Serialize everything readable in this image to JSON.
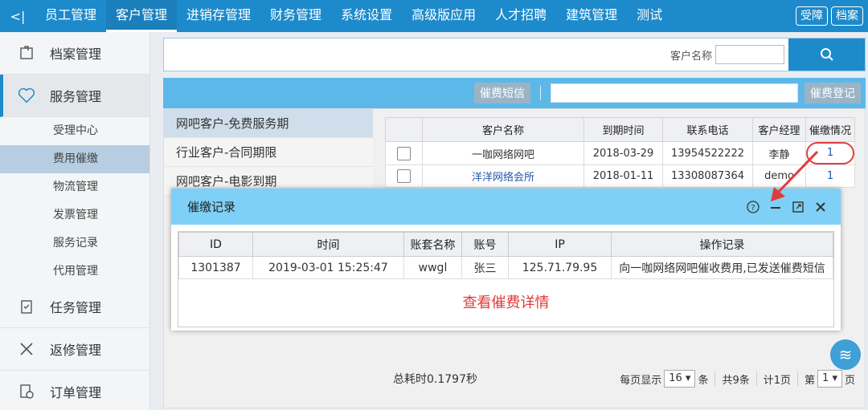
{
  "topnav": {
    "back": "<|",
    "items": [
      "员工管理",
      "客户管理",
      "进销存管理",
      "财务管理",
      "系统设置",
      "高级版应用",
      "人才招聘",
      "建筑管理",
      "测试"
    ],
    "right": [
      "受障",
      "档案"
    ]
  },
  "sidebar": {
    "main1": "档案管理",
    "main2": "服务管理",
    "subs": [
      "受理中心",
      "费用催缴",
      "物流管理",
      "发票管理",
      "服务记录",
      "代用管理"
    ],
    "main3": "任务管理",
    "main4": "返修管理",
    "main5": "订单管理"
  },
  "search": {
    "label": "客户名称"
  },
  "toolbar": {
    "sms": "催费短信",
    "register": "催费登记"
  },
  "types": [
    "网吧客户-免费服务期",
    "行业客户-合同期限",
    "网吧客户-电影到期"
  ],
  "grid": {
    "headers": [
      "客户名称",
      "到期时间",
      "联系电话",
      "客户经理",
      "催缴情况"
    ],
    "rows": [
      {
        "name": "一咖网络网吧",
        "date": "2018-03-29",
        "phone": "13954522222",
        "mgr": "李静",
        "status": "1"
      },
      {
        "name": "洋洋网络会所",
        "date": "2018-01-11",
        "phone": "13308087364",
        "mgr": "demo",
        "status": "1"
      }
    ]
  },
  "footer": {
    "total": "总耗时0.1797秒",
    "per_page": "每页显示",
    "per_page_val": "16",
    "unit": "条",
    "count": "共9条",
    "pages": "计1页",
    "page_prefix": "第",
    "page_val": "1",
    "page_suffix": "页"
  },
  "dialog": {
    "title": "催缴记录",
    "headers": [
      "ID",
      "时间",
      "账套名称",
      "账号",
      "IP",
      "操作记录"
    ],
    "row": {
      "id": "1301387",
      "time": "2019-03-01 15:25:47",
      "set": "wwgl",
      "account": "张三",
      "ip": "125.71.79.95",
      "log": "向一咖网络网吧催收费用,已发送催费短信"
    },
    "detail_link": "查看催费详情"
  },
  "colors": {
    "nav": "#1d8acb",
    "toolbar": "#5db8ea",
    "dialog_head": "#7ed0f6",
    "accent_red": "#e03a3a"
  }
}
